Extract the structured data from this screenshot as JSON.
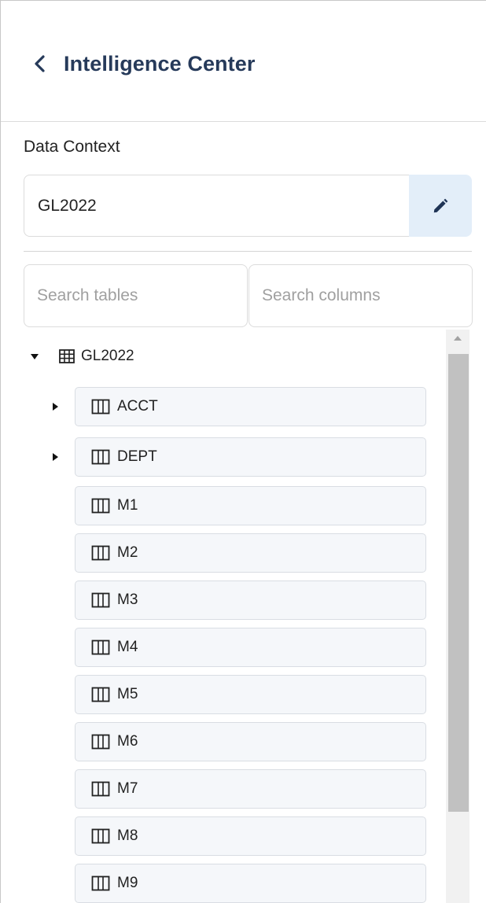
{
  "header": {
    "title": "Intelligence Center",
    "back_icon": "chevron-left-icon",
    "title_color": "#263a5a"
  },
  "data_context": {
    "label": "Data Context",
    "value": "GL2022",
    "edit_icon": "pencil-icon",
    "edit_bg": "#e3eef9"
  },
  "search": {
    "tables_placeholder": "Search tables",
    "columns_placeholder": "Search columns"
  },
  "tree": {
    "root": {
      "label": "GL2022",
      "icon": "table-grid-icon",
      "expanded": true
    },
    "columns": [
      {
        "label": "ACCT",
        "expandable": true
      },
      {
        "label": "DEPT",
        "expandable": true
      },
      {
        "label": "M1",
        "expandable": false
      },
      {
        "label": "M2",
        "expandable": false
      },
      {
        "label": "M3",
        "expandable": false
      },
      {
        "label": "M4",
        "expandable": false
      },
      {
        "label": "M5",
        "expandable": false
      },
      {
        "label": "M6",
        "expandable": false
      },
      {
        "label": "M7",
        "expandable": false
      },
      {
        "label": "M8",
        "expandable": false
      },
      {
        "label": "M9",
        "expandable": false
      }
    ]
  }
}
